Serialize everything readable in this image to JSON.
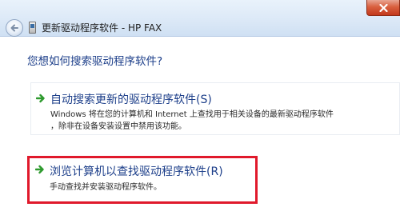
{
  "window": {
    "title": "更新驱动程序软件 - HP FAX"
  },
  "content": {
    "question": "您想如何搜索驱动程序软件?"
  },
  "options": [
    {
      "title": "自动搜索更新的驱动程序软件(S)",
      "desc_line1": "Windows 将在您的计算机和 Internet 上查找用于相关设备的最新驱动程序软件",
      "desc_line2": "，除非在设备安装设置中禁用该功能。"
    },
    {
      "title": "浏览计算机以查找驱动程序软件(R)",
      "desc_line1": "手动查找并安装驱动程序软件。"
    }
  ],
  "colors": {
    "link_blue": "#1d3f8a",
    "arrow_green": "#2e9a2e",
    "highlight_red": "#e0192b"
  },
  "icons": {
    "back": "back-arrow-icon",
    "close": "close-icon",
    "option_arrow": "green-arrow-icon"
  }
}
